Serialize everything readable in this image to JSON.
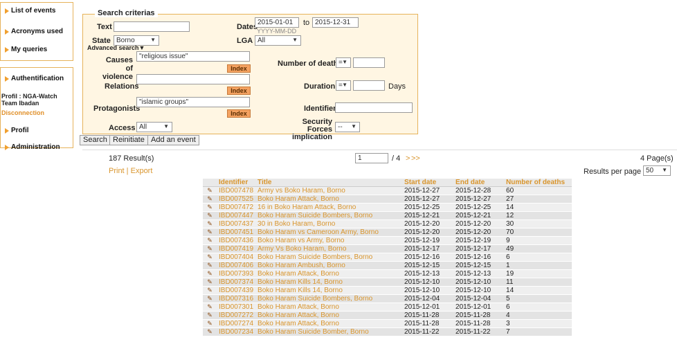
{
  "sidebar": {
    "top_items": [
      "List of events",
      "Acronyms used",
      "My queries"
    ],
    "auth_label": "Authentification",
    "profile_text": "Profil : NGA-Watch Team Ibadan",
    "disconnect": "Disconnection",
    "profil": "Profil",
    "administration": "Administration"
  },
  "search": {
    "legend": "Search criterias",
    "text_label": "Text",
    "text_value": "",
    "dates_label": "Dates",
    "date_from": "2015-01-01",
    "date_to_label": "to",
    "date_to": "2015-12-31",
    "date_hint": "YYYY-MM-DD",
    "state_label": "State",
    "state_value": "Borno",
    "lga_label": "LGA",
    "lga_value": "All",
    "advanced": "Advanced search",
    "causes_label": "Causes of violence",
    "causes_value": "\"religious issue\"",
    "relations_label": "Relations",
    "relations_value": "",
    "protagonists_label": "Protagonists",
    "protagonists_value": "\"islamic groups\"",
    "index_label": "Index",
    "deaths_label": "Number of deaths",
    "deaths_op": "=",
    "deaths_value": "",
    "duration_label": "Duration",
    "duration_op": "=",
    "duration_value": "",
    "days_label": "Days",
    "identifier_label": "Identifier",
    "identifier_value": "",
    "access_label": "Access",
    "access_value": "All",
    "security_label": "Security Forces implication",
    "security_value": "--"
  },
  "buttons": {
    "search": "Search",
    "reinitiate": "Reinitiate",
    "add_event": "Add an event"
  },
  "results": {
    "count": "187 Result(s)",
    "print": "Print",
    "sep": " | ",
    "export": "Export",
    "page_value": "1",
    "page_of": "/ 4",
    "next": ">",
    "last": ">>",
    "pages": "4 Page(s)",
    "per_page_label": "Results per page",
    "per_page": "50"
  },
  "table": {
    "headers": [
      "Identifier",
      "Title",
      "Start date",
      "End date",
      "Number of deaths"
    ],
    "rows": [
      [
        "IBD007478",
        "Army vs Boko Haram, Borno",
        "2015-12-27",
        "2015-12-28",
        "60"
      ],
      [
        "IBD007525",
        "Boko Haram Attack, Borno",
        "2015-12-27",
        "2015-12-27",
        "27"
      ],
      [
        "IBD007472",
        "16 in Boko Haram Attack, Borno",
        "2015-12-25",
        "2015-12-25",
        "14"
      ],
      [
        "IBD007447",
        "Boko Haram Suicide Bombers, Borno",
        "2015-12-21",
        "2015-12-21",
        "12"
      ],
      [
        "IBD007437",
        "30 in Boko Haram, Borno",
        "2015-12-20",
        "2015-12-20",
        "30"
      ],
      [
        "IBD007451",
        "Boko Haram vs Cameroon Army, Borno",
        "2015-12-20",
        "2015-12-20",
        "70"
      ],
      [
        "IBD007436",
        "Boko Haram vs Army, Borno",
        "2015-12-19",
        "2015-12-19",
        "9"
      ],
      [
        "IBD007419",
        "Army Vs Boko Haram, Borno",
        "2015-12-17",
        "2015-12-17",
        "49"
      ],
      [
        "IBD007404",
        "Boko Haram Suicide Bombers, Borno",
        "2015-12-16",
        "2015-12-16",
        "6"
      ],
      [
        "IBD007406",
        "Boko Haram Ambush, Borno",
        "2015-12-15",
        "2015-12-15",
        "1"
      ],
      [
        "IBD007393",
        "Boko Haram Attack, Borno",
        "2015-12-13",
        "2015-12-13",
        "19"
      ],
      [
        "IBD007374",
        "Boko Haram Kills 14, Borno",
        "2015-12-10",
        "2015-12-10",
        "11"
      ],
      [
        "IBD007439",
        "Boko Haram Kills 14, Borno",
        "2015-12-10",
        "2015-12-10",
        "14"
      ],
      [
        "IBD007316",
        "Boko Haram Suicide Bombers, Borno",
        "2015-12-04",
        "2015-12-04",
        "5"
      ],
      [
        "IBD007301",
        "Boko Haram Attack, Borno",
        "2015-12-01",
        "2015-12-01",
        "6"
      ],
      [
        "IBD007272",
        "Boko Haram Attack, Borno",
        "2015-11-28",
        "2015-11-28",
        "4"
      ],
      [
        "IBD007274",
        "Boko Haram Attack, Borno",
        "2015-11-28",
        "2015-11-28",
        "3"
      ],
      [
        "IBD007234",
        "Boko Haram Suicide Bomber, Borno",
        "2015-11-22",
        "2015-11-22",
        "7"
      ]
    ]
  }
}
